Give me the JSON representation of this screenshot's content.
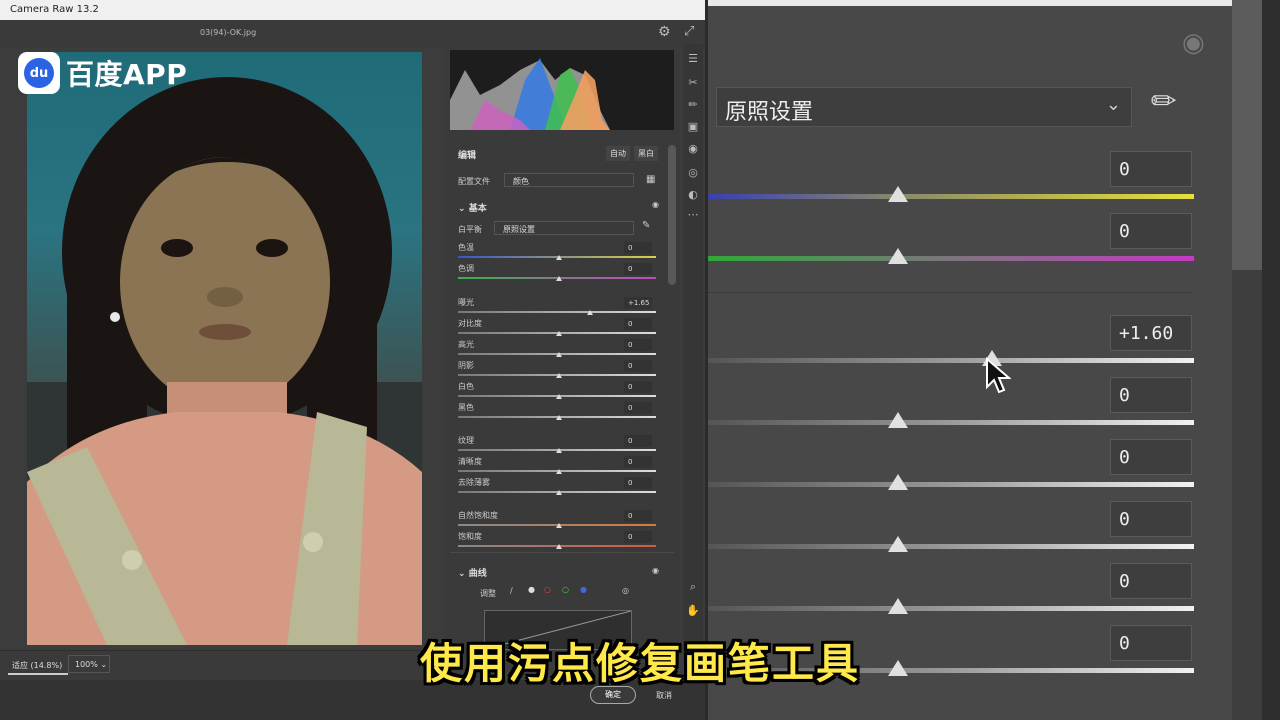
{
  "window": {
    "title": "Camera Raw 13.2",
    "filename": "03(94)-OK.jpg"
  },
  "brand": {
    "logo_text": "百度APP"
  },
  "footer": {
    "fit": "适应 (14.8%)",
    "zoom": "100%",
    "ok": "确定",
    "cancel": "取消"
  },
  "panel": {
    "edit_title": "编辑",
    "auto": "自动",
    "bw": "黑白",
    "profile_label": "配置文件",
    "profile_value": "颜色",
    "basic": "基本",
    "wb_label": "白平衡",
    "wb_value": "原照设置",
    "sliders": [
      {
        "label": "色温",
        "value": "0"
      },
      {
        "label": "色调",
        "value": "0"
      },
      {
        "label": "曝光",
        "value": "+1.65"
      },
      {
        "label": "对比度",
        "value": "0"
      },
      {
        "label": "高光",
        "value": "0"
      },
      {
        "label": "阴影",
        "value": "0"
      },
      {
        "label": "白色",
        "value": "0"
      },
      {
        "label": "黑色",
        "value": "0"
      },
      {
        "label": "纹理",
        "value": "0"
      },
      {
        "label": "清晰度",
        "value": "0"
      },
      {
        "label": "去除薄雾",
        "value": "0"
      },
      {
        "label": "自然饱和度",
        "value": "0"
      },
      {
        "label": "饱和度",
        "value": "0"
      }
    ],
    "curves": "曲线",
    "adjust": "调整"
  },
  "zoom": {
    "wb_value": "原照设置",
    "values": [
      "0",
      "0",
      "+1.60",
      "0",
      "0",
      "0",
      "0",
      "0"
    ]
  },
  "caption": "使用污点修复画笔工具",
  "icons": {
    "gear": "gear-icon",
    "fullscreen": "fullscreen-icon",
    "eye": "eye-icon",
    "eyedropper": "eyedropper-icon",
    "chevron": "chevron-down-icon",
    "cursor": "cursor-icon"
  }
}
